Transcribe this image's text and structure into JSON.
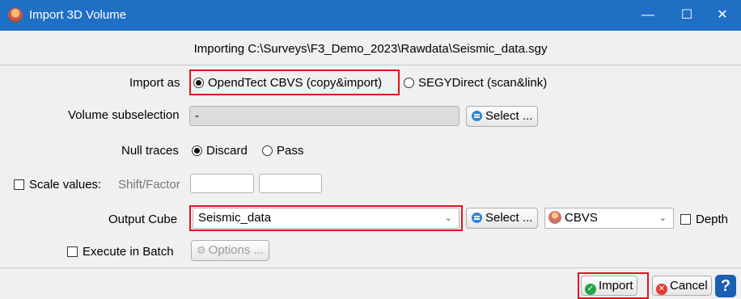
{
  "window": {
    "title": "Import 3D Volume",
    "icon": "opendtect-app-icon"
  },
  "window_controls": {
    "minimize": "—",
    "maximize": "☐",
    "close": "✕"
  },
  "header": {
    "importing_text": "Importing C:\\Surveys\\F3_Demo_2023\\Rawdata\\Seismic_data.sgy"
  },
  "import_as": {
    "label": "Import as",
    "options": [
      {
        "label": "OpendTect CBVS (copy&import)",
        "selected": true
      },
      {
        "label": "SEGYDirect (scan&link)",
        "selected": false
      }
    ]
  },
  "volume_subselection": {
    "label": "Volume subselection",
    "value": "-",
    "select_button": "Select ..."
  },
  "null_traces": {
    "label": "Null traces",
    "options": [
      {
        "label": "Discard",
        "selected": true
      },
      {
        "label": "Pass",
        "selected": false
      }
    ]
  },
  "scale_values": {
    "label": "Scale values:",
    "checked": false,
    "shift_factor_label": "Shift/Factor",
    "shift": "",
    "factor": ""
  },
  "output_cube": {
    "label": "Output Cube",
    "value": "Seismic_data",
    "select_button": "Select ...",
    "format": "CBVS",
    "depth_label": "Depth",
    "depth_checked": false
  },
  "execute_in_batch": {
    "label": "Execute in Batch",
    "checked": false,
    "options_button": "Options ..."
  },
  "footer": {
    "import_button": "Import",
    "cancel_button": "Cancel",
    "help_button": "?"
  },
  "colors": {
    "titlebar": "#1f6fc5",
    "highlight": "#e0141e"
  }
}
